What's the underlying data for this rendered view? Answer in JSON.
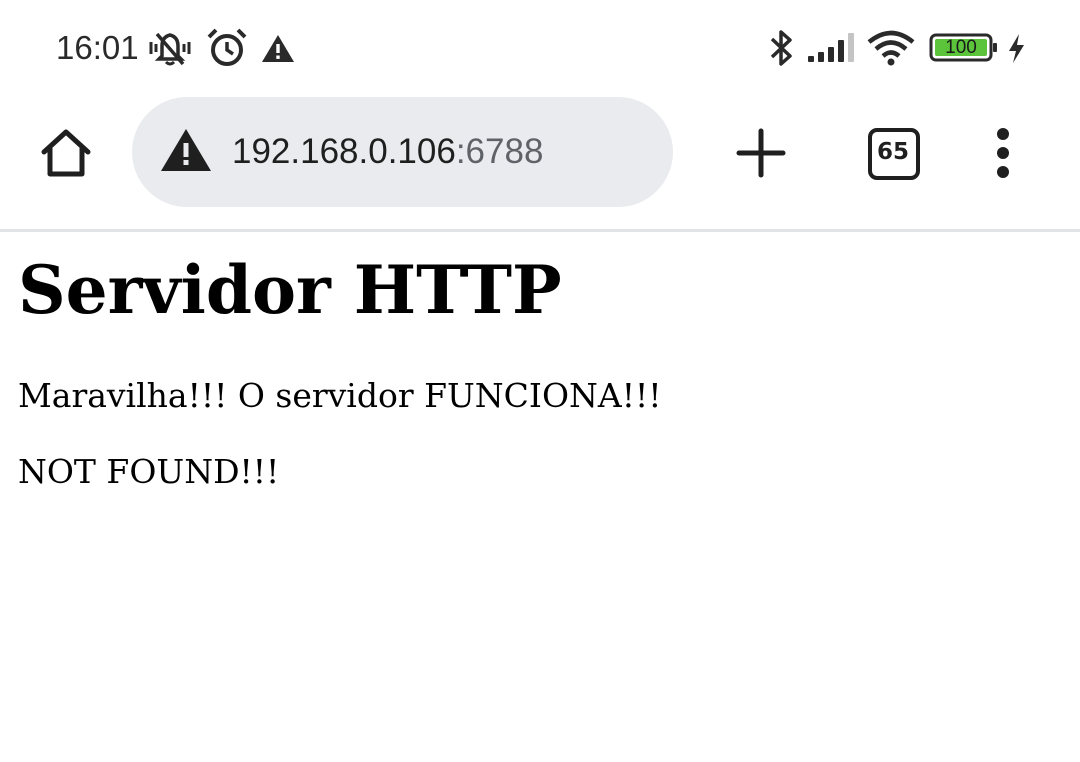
{
  "status_bar": {
    "time": "16:01",
    "battery_level": "100",
    "icons": [
      "muted-notifications-icon",
      "alarm-icon",
      "warning-icon",
      "bluetooth-icon",
      "cellular-signal-icon",
      "wifi-icon",
      "battery-icon",
      "charging-icon"
    ]
  },
  "toolbar": {
    "url_host": "192.168.0.106",
    "url_port": ":6788",
    "tab_count": "65",
    "icons": [
      "home-icon",
      "not-secure-warning-icon",
      "new-tab-plus-icon",
      "tab-switcher-icon",
      "more-menu-icon"
    ]
  },
  "page": {
    "heading": "Servidor HTTP",
    "paragraphs": [
      "Maravilha!!! O servidor FUNCIONA!!!",
      "NOT FOUND!!!"
    ]
  },
  "colors": {
    "omnibox_bg": "#eaebef",
    "battery_fill": "#5cc43b",
    "divider": "#e2e3e6"
  }
}
